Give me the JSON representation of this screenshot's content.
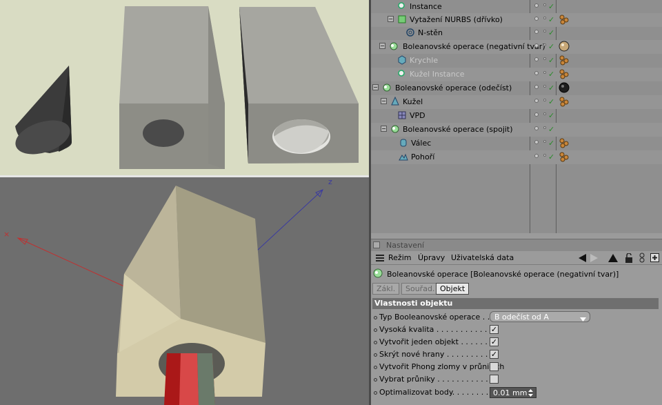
{
  "object_manager": {
    "rows": [
      {
        "label": "Instance",
        "disabled": false
      },
      {
        "label": "Vytažení NURBS (dřívko)",
        "disabled": false
      },
      {
        "label": "N-stěn",
        "disabled": false
      },
      {
        "label": "Boleanovské operace (negativní tvar)",
        "disabled": false
      },
      {
        "label": "Krychle",
        "disabled": true
      },
      {
        "label": "Kužel Instance",
        "disabled": true
      },
      {
        "label": "Boleanovské operace (odečíst)",
        "disabled": false
      },
      {
        "label": "Kužel",
        "disabled": false
      },
      {
        "label": "VPD",
        "disabled": false
      },
      {
        "label": "Boleanovské operace (spojit)",
        "disabled": false
      },
      {
        "label": "Válec",
        "disabled": false
      },
      {
        "label": "Pohoří",
        "disabled": false
      }
    ]
  },
  "attributes": {
    "title": "Nastavení",
    "menu": [
      "Režim",
      "Úpravy",
      "Uživatelská data"
    ],
    "object_header": "Boleanovské operace [Boleanovské operace (negativní tvar)]",
    "tabs": [
      "Zákl.",
      "Souřad.",
      "Objekt"
    ],
    "active_tab": "Objekt",
    "section": "Vlastnosti objektu",
    "props": [
      {
        "label": "Typ Booleanovské operace . . . .",
        "kind": "select",
        "value": "B odečíst od A"
      },
      {
        "label": "Vysoká kvalita . . . . . . . . . . . . .",
        "kind": "check",
        "value": true
      },
      {
        "label": "Vytvořit jeden objekt . . . . . . . .",
        "kind": "check",
        "value": true
      },
      {
        "label": "Skrýt nové hrany . . . . . . . . . . .",
        "kind": "check",
        "value": true
      },
      {
        "label": "Vytvořit Phong zlomy v průnicích",
        "kind": "check",
        "value": false
      },
      {
        "label": "Vybrat průniky . . . . . . . . . . . . .",
        "kind": "check",
        "value": false
      },
      {
        "label": "Optimalizovat body. . . . . . . . . .",
        "kind": "number",
        "value": "0.01 mm"
      }
    ]
  },
  "colors": {
    "viewport_top_bg": "#d9dcc3",
    "viewport_bottom_bg": "#6e6e6e",
    "panel_bg": "#8f8f8f",
    "section_bg": "#6f6f6f",
    "check_green": "#2a8a2a"
  }
}
